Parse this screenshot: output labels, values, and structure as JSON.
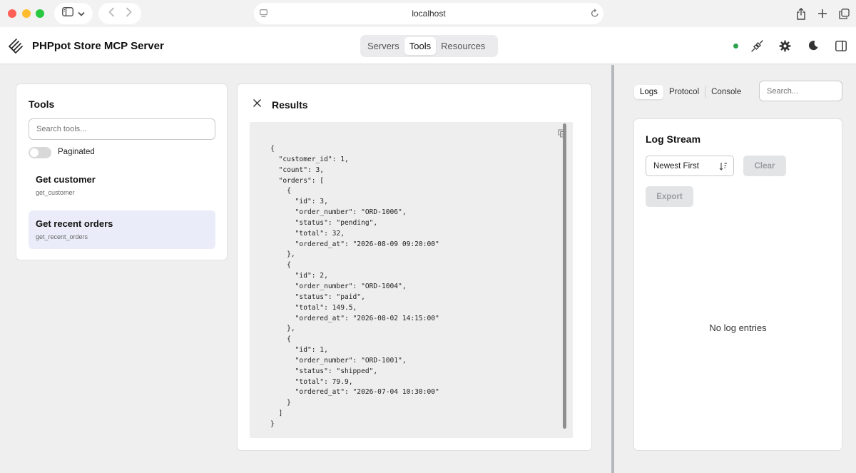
{
  "browser": {
    "url": "localhost"
  },
  "header": {
    "title": "PHPpot Store MCP Server",
    "tabs": [
      {
        "label": "Servers",
        "active": false
      },
      {
        "label": "Tools",
        "active": true
      },
      {
        "label": "Resources",
        "active": false
      }
    ],
    "status_color": "#2ba24c"
  },
  "tools_panel": {
    "title": "Tools",
    "search_placeholder": "Search tools...",
    "paginated_label": "Paginated",
    "paginated_on": false,
    "items": [
      {
        "name": "Get customer",
        "id": "get_customer",
        "selected": false
      },
      {
        "name": "Get recent orders",
        "id": "get_recent_orders",
        "selected": true
      }
    ]
  },
  "results_panel": {
    "title": "Results",
    "json_text": "{\n  \"customer_id\": 1,\n  \"count\": 3,\n  \"orders\": [\n    {\n      \"id\": 3,\n      \"order_number\": \"ORD-1006\",\n      \"status\": \"pending\",\n      \"total\": 32,\n      \"ordered_at\": \"2026-08-09 09:20:00\"\n    },\n    {\n      \"id\": 2,\n      \"order_number\": \"ORD-1004\",\n      \"status\": \"paid\",\n      \"total\": 149.5,\n      \"ordered_at\": \"2026-08-02 14:15:00\"\n    },\n    {\n      \"id\": 1,\n      \"order_number\": \"ORD-1001\",\n      \"status\": \"shipped\",\n      \"total\": 79.9,\n      \"ordered_at\": \"2026-07-04 10:30:00\"\n    }\n  ]\n}"
  },
  "log_panel": {
    "tabs": [
      {
        "label": "Logs",
        "active": true
      },
      {
        "label": "Protocol",
        "active": false
      },
      {
        "label": "Console",
        "active": false
      }
    ],
    "search_placeholder": "Search...",
    "title": "Log Stream",
    "sort_value": "Newest First",
    "clear_label": "Clear",
    "export_label": "Export",
    "empty_text": "No log entries"
  }
}
